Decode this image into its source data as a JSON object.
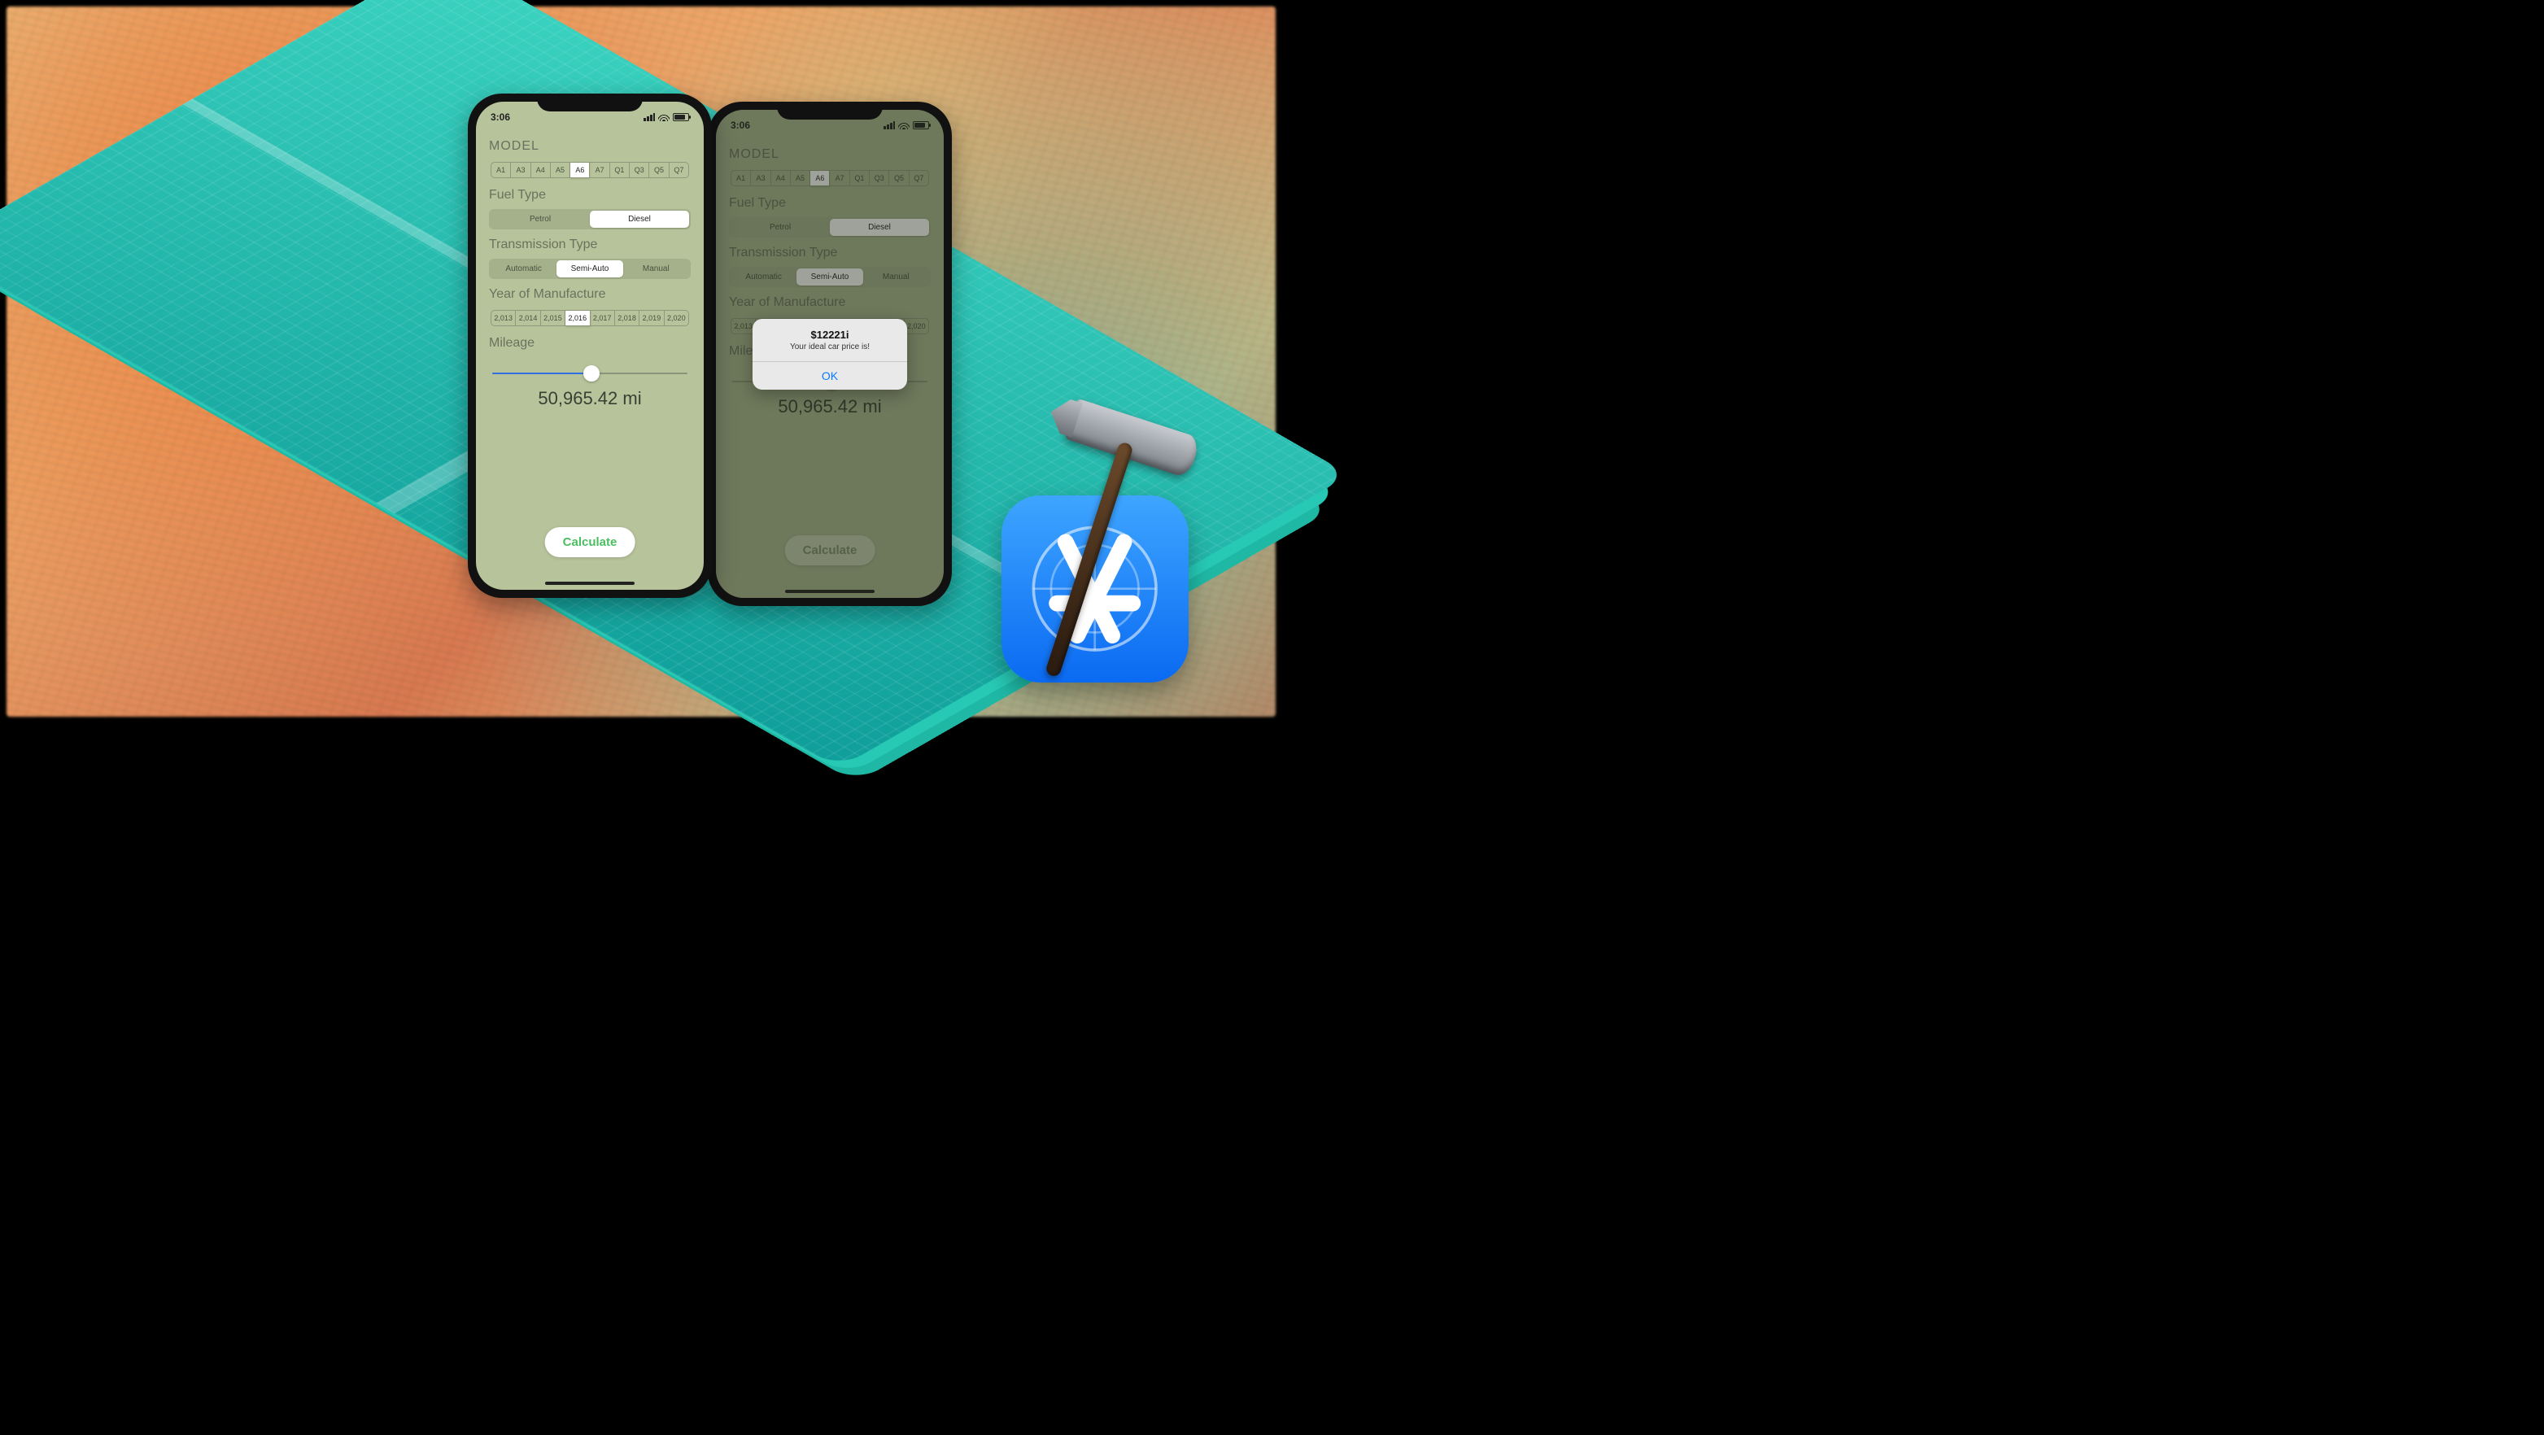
{
  "statusbar": {
    "time": "3:06"
  },
  "sections": {
    "model": "MODEL",
    "fuel": "Fuel Type",
    "trans": "Transmission Type",
    "year": "Year of Manufacture",
    "mileage": "Mileage"
  },
  "model": {
    "options": [
      "A1",
      "A3",
      "A4",
      "A5",
      "A6",
      "A7",
      "Q1",
      "Q3",
      "Q5",
      "Q7"
    ],
    "selected": "A6"
  },
  "fuel": {
    "options": [
      "Petrol",
      "Diesel"
    ],
    "selected": "Diesel"
  },
  "transmission": {
    "options": [
      "Automatic",
      "Semi-Auto",
      "Manual"
    ],
    "selected": "Semi-Auto"
  },
  "year": {
    "options": [
      "2,013",
      "2,014",
      "2,015",
      "2,016",
      "2,017",
      "2,018",
      "2,019",
      "2,020"
    ],
    "selected": "2,016"
  },
  "mileage": {
    "value_display": "50,965.42 mi",
    "slider_fraction": 0.51
  },
  "calculate_label": "Calculate",
  "alert": {
    "title": "$12221i",
    "message": "Your ideal car price is!",
    "ok": "OK"
  },
  "icons": {
    "createml": "ML",
    "coreml": "ML"
  }
}
